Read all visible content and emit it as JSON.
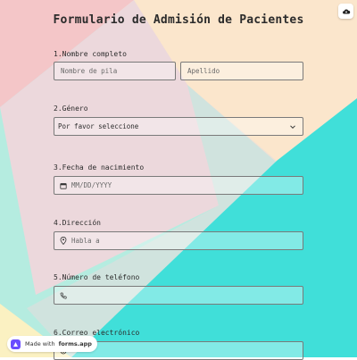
{
  "colors": {
    "pink": "#f4c6c8",
    "mint": "#b5ece0",
    "peach": "#fbe6cc",
    "turquoise": "#40dfd9",
    "lavender_veil": "#ead7dc",
    "yellow": "#fbf1c2"
  },
  "form": {
    "title": "Formulario de Admisión de Pacientes"
  },
  "questions": {
    "name": {
      "label": "1.Nombre completo",
      "first_placeholder": "Nombre de pila",
      "last_placeholder": "Apellido"
    },
    "gender": {
      "label": "2.Género",
      "selected": "Por favor seleccione"
    },
    "birthdate": {
      "label": "3.Fecha de nacimiento",
      "placeholder": "MM/DD/YYYY"
    },
    "address": {
      "label": "4.Dirección",
      "placeholder": "Habla a"
    },
    "phone": {
      "label": "5.Número de teléfono",
      "placeholder": ""
    },
    "email": {
      "label": "6.Correo electrónico"
    }
  },
  "badge": {
    "prefix": "Made with",
    "brand": "forms.app"
  },
  "icons": {
    "corner": "cloud-icon",
    "gender": "chevron-down-icon",
    "birthdate": "calendar-icon",
    "address": "location-pin-icon",
    "phone": "phone-icon",
    "badge": "forms-app-logo-icon"
  }
}
